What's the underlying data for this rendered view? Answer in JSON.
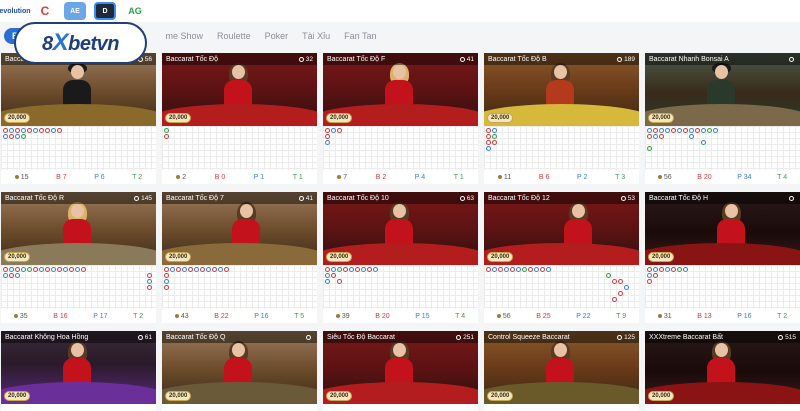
{
  "header": {
    "providers": [
      {
        "name": "provider-evolution-icon",
        "label": "evolution"
      },
      {
        "name": "provider-c-icon",
        "label": "C"
      },
      {
        "name": "provider-ae-icon",
        "label": "AE"
      },
      {
        "name": "provider-dark-icon",
        "label": "D"
      },
      {
        "name": "provider-ag-icon",
        "label": "AG"
      }
    ]
  },
  "logo": {
    "prefix": "8",
    "x": "X",
    "suffix": "betvn"
  },
  "categories": {
    "active": "Ba",
    "items": [
      "me Show",
      "Roulette",
      "Poker",
      "Tài Xỉu",
      "Fan Tan"
    ]
  },
  "tables": [
    {
      "title": "Baccarat",
      "viewers": "56",
      "bet": "20,000",
      "total": "15",
      "b": "B 7",
      "p": "P 6",
      "t": "T 2"
    },
    {
      "title": "Baccarat Tốc Độ",
      "viewers": "32",
      "bet": "20,000",
      "total": "2",
      "b": "B 0",
      "p": "P 1",
      "t": "T 1"
    },
    {
      "title": "Baccarat Tốc Độ F",
      "viewers": "41",
      "bet": "20,000",
      "total": "7",
      "b": "B 2",
      "p": "P 4",
      "t": "T 1"
    },
    {
      "title": "Baccarat Tốc Độ B",
      "viewers": "189",
      "bet": "20,000",
      "total": "11",
      "b": "B 6",
      "p": "P 2",
      "t": "T 3"
    },
    {
      "title": "Baccarat Nhanh Bonsai A",
      "viewers": "",
      "bet": "20,000",
      "total": "56",
      "b": "B 20",
      "p": "P 34",
      "t": "T 4"
    },
    {
      "title": "Baccarat Tốc Độ R",
      "viewers": "145",
      "bet": "20,000",
      "total": "35",
      "b": "B 16",
      "p": "P 17",
      "t": "T 2"
    },
    {
      "title": "Baccarat Tốc Độ 7",
      "viewers": "41",
      "bet": "20,000",
      "total": "43",
      "b": "B 22",
      "p": "P 16",
      "t": "T 5"
    },
    {
      "title": "Baccarat Tốc Độ 10",
      "viewers": "63",
      "bet": "20,000",
      "total": "39",
      "b": "B 20",
      "p": "P 15",
      "t": "T 4"
    },
    {
      "title": "Baccarat Tốc Độ 12",
      "viewers": "53",
      "bet": "20,000",
      "total": "56",
      "b": "B 25",
      "p": "P 22",
      "t": "T 9"
    },
    {
      "title": "Baccarat Tốc Độ H",
      "viewers": "",
      "bet": "20,000",
      "total": "31",
      "b": "B 13",
      "p": "P 16",
      "t": "T 2"
    },
    {
      "title": "Baccarat Không Hoa Hồng",
      "viewers": "61",
      "bet": "20,000"
    },
    {
      "title": "Baccarat Tốc Độ Q",
      "viewers": "",
      "bet": "20,000"
    },
    {
      "title": "Siêu Tốc Độ Baccarat",
      "viewers": "251",
      "bet": "20,000"
    },
    {
      "title": "Control Squeeze Baccarat",
      "viewers": "125",
      "bet": "20,000"
    },
    {
      "title": "XXXtreme Baccarat Bất",
      "viewers": "515",
      "bet": "20,000"
    }
  ]
}
